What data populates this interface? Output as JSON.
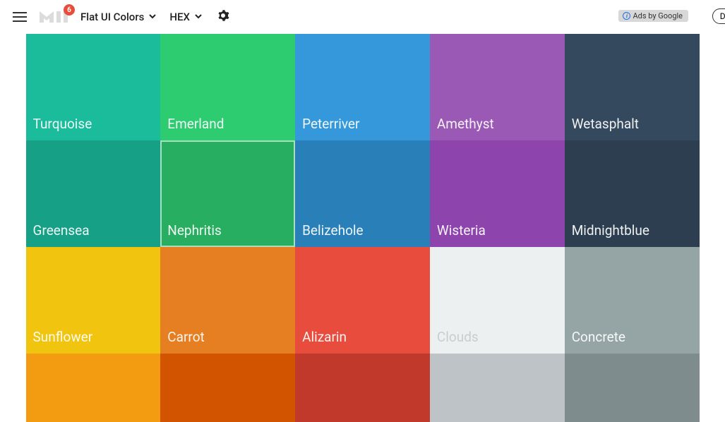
{
  "header": {
    "badge_count": "6",
    "palette_name": "Flat UI Colors",
    "format": "HEX",
    "ads_label": "Ads by Google",
    "partial_button": "De"
  },
  "swatches": [
    {
      "name": "Turquoise",
      "color": "#1abc9c",
      "row": 1
    },
    {
      "name": "Emerland",
      "color": "#2ecc71",
      "row": 1
    },
    {
      "name": "Peterriver",
      "color": "#3498db",
      "row": 1
    },
    {
      "name": "Amethyst",
      "color": "#9b59b6",
      "row": 1
    },
    {
      "name": "Wetasphalt",
      "color": "#34495e",
      "row": 1
    },
    {
      "name": "Greensea",
      "color": "#16a085",
      "row": 2
    },
    {
      "name": "Nephritis",
      "color": "#27ae60",
      "row": 2,
      "highlighted": true
    },
    {
      "name": "Belizehole",
      "color": "#2980b9",
      "row": 2
    },
    {
      "name": "Wisteria",
      "color": "#8e44ad",
      "row": 2
    },
    {
      "name": "Midnightblue",
      "color": "#2c3e50",
      "row": 2
    },
    {
      "name": "Sunflower",
      "color": "#f1c40f",
      "row": 3
    },
    {
      "name": "Carrot",
      "color": "#e67e22",
      "row": 3
    },
    {
      "name": "Alizarin",
      "color": "#e74c3c",
      "row": 3
    },
    {
      "name": "Clouds",
      "color": "#ecf0f1",
      "row": 3,
      "light": true
    },
    {
      "name": "Concrete",
      "color": "#95a5a6",
      "row": 3
    },
    {
      "name": "",
      "color": "#f39c12",
      "row": 4
    },
    {
      "name": "",
      "color": "#d35400",
      "row": 4
    },
    {
      "name": "",
      "color": "#c0392b",
      "row": 4
    },
    {
      "name": "",
      "color": "#bdc3c7",
      "row": 4
    },
    {
      "name": "",
      "color": "#7f8c8d",
      "row": 4
    }
  ]
}
